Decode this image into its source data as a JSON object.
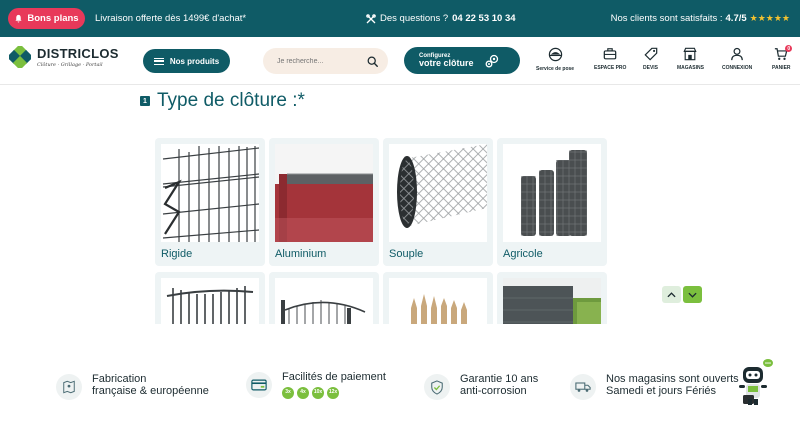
{
  "topbar": {
    "promo_label": "Bons plans",
    "shipping": "Livraison offerte dès 1499€ d'achat*",
    "questions_label": "Des questions ?",
    "phone": "04 22 53 10 34",
    "satisfied_label": "Nos clients sont satisfaits :",
    "score": "4.7/5",
    "stars": "★★★★★"
  },
  "header": {
    "logo_name": "DISTRICLOS",
    "logo_tagline": "Clôture · Grillage · Portail",
    "products_label": "Nos produits",
    "search_placeholder": "Je recherche...",
    "config_line1": "Configurez",
    "config_line2": "votre clôture",
    "nav": [
      {
        "label": "Service de pose",
        "icon": "worker-helmet-icon"
      },
      {
        "label": "ESPACE PRO",
        "icon": "briefcase-icon"
      },
      {
        "label": "DEVIS",
        "icon": "tag-icon"
      },
      {
        "label": "MAGASINS",
        "icon": "store-icon"
      },
      {
        "label": "CONNEXION",
        "icon": "user-icon"
      },
      {
        "label": "PANIER",
        "icon": "cart-icon",
        "badge": "0"
      }
    ]
  },
  "configurator": {
    "step_number": "1",
    "step_label": "Type de clôture :*",
    "options": [
      {
        "label": "Rigide"
      },
      {
        "label": "Aluminium"
      },
      {
        "label": "Souple"
      },
      {
        "label": "Agricole"
      },
      {
        "label": ""
      },
      {
        "label": ""
      },
      {
        "label": ""
      },
      {
        "label": ""
      }
    ]
  },
  "features": [
    {
      "line1": "Fabrication",
      "line2": "française & européenne",
      "icon": "map-pin-icon"
    },
    {
      "line1": "Facilités de paiement",
      "line2": "",
      "icon": "credit-card-icon",
      "chips": [
        "3x",
        "4x",
        "10x",
        "12x"
      ]
    },
    {
      "line1": "Garantie 10 ans",
      "line2": "anti-corrosion",
      "icon": "shield-check-icon"
    },
    {
      "line1": "Nos magasins sont ouverts",
      "line2": "Samedi et jours Fériés",
      "icon": "delivery-truck-icon"
    }
  ],
  "colors": {
    "brand": "#0f5b66",
    "accent_red": "#e8395a",
    "accent_green": "#7bbf3e",
    "star": "#f2c230"
  }
}
